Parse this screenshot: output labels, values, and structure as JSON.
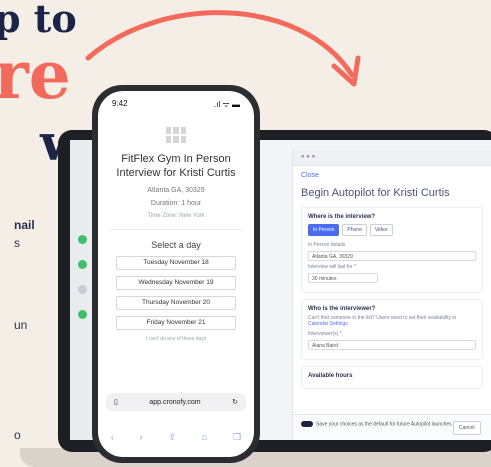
{
  "hero": {
    "line1": "p to",
    "line2": "re",
    "line3": "ws"
  },
  "side_text": {
    "bold": "nail",
    "s": "s",
    "un": "un",
    "o": "o"
  },
  "phone": {
    "time": "9:42",
    "status_icons": ".ıl ᯤ ▬",
    "title": "FitFlex Gym In Person Interview for Kristi Curtis",
    "address": "Atlanta GA, 30329",
    "duration": "Duration: 1 hour",
    "timezone": "Time Zone: New York",
    "select_label": "Select a day",
    "days": [
      "Tuesday November 18",
      "Wednesday November 19",
      "Thursday November 20",
      "Friday November 21"
    ],
    "none_text": "I can't do any of these days",
    "url": "app.cronofy.com",
    "reader_icon": "reader-icon",
    "reload_icon": "reload-icon"
  },
  "laptop": {
    "close": "Close",
    "title": "Begin Autopilot for Kristi Curtis",
    "where_label": "Where is the interview?",
    "modes": [
      "In Person",
      "Phone",
      "Video"
    ],
    "in_person_label": "In Person details",
    "address_value": "Atlanta GA, 30329",
    "duration_label": "Interview will last for *",
    "duration_value": "30 minutes",
    "who_label": "Who is the interviewer?",
    "who_hint": "Can't find someone in the list? Users need to set their availability in",
    "who_link": "Calendar Settings",
    "interviewer_label": "Interviewer(s) *",
    "interviewer_value": "Alana Baird",
    "avail_label": "Available hours",
    "footer_text": "Save your choices as the default for future Autopilot launches in this step.",
    "cancel": "Cancel"
  },
  "colors": {
    "accent": "#f26a5b",
    "navy": "#1c2547",
    "brand": "#4a6cf0"
  }
}
